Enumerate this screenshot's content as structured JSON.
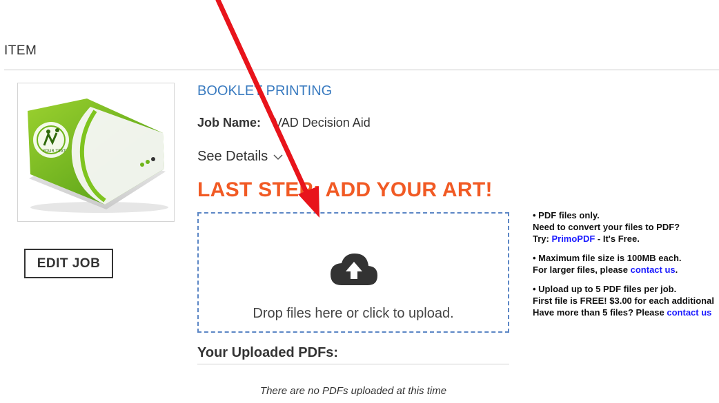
{
  "section": {
    "title": "ITEM"
  },
  "product": {
    "name": "BOOKLET PRINTING",
    "job_label": "Job Name:",
    "job_value": "VAD Decision Aid",
    "see_details": "See Details"
  },
  "thumbnail": {
    "caption": "YOUR TEXT"
  },
  "edit_button": "EDIT JOB",
  "upload": {
    "heading": "LAST STEP: ADD YOUR ART!",
    "drop_text": "Drop files here or click to upload.",
    "uploaded_title": "Your Uploaded PDFs:",
    "empty_text": "There are no PDFs uploaded at this time"
  },
  "info": {
    "line1": "• PDF files only.",
    "line2": "Need to convert your files to PDF?",
    "line3_prefix": "Try: ",
    "line3_link": "PrimoPDF",
    "line3_suffix": " - It's Free.",
    "line4": "• Maximum file size is 100MB each.",
    "line5_prefix": "For larger files, please ",
    "line5_link": "contact us",
    "line5_suffix": ".",
    "line6": "• Upload up to 5 PDF files per job.",
    "line7": "First file is FREE! $3.00 for each additional",
    "line8_prefix": "Have more than 5 files? Please ",
    "line8_link": "contact us"
  },
  "colors": {
    "accent_orange": "#f15a24",
    "link_blue": "#3a7bc0",
    "dropzone_border": "#5b86c5",
    "annotation_arrow": "#e8141b"
  }
}
